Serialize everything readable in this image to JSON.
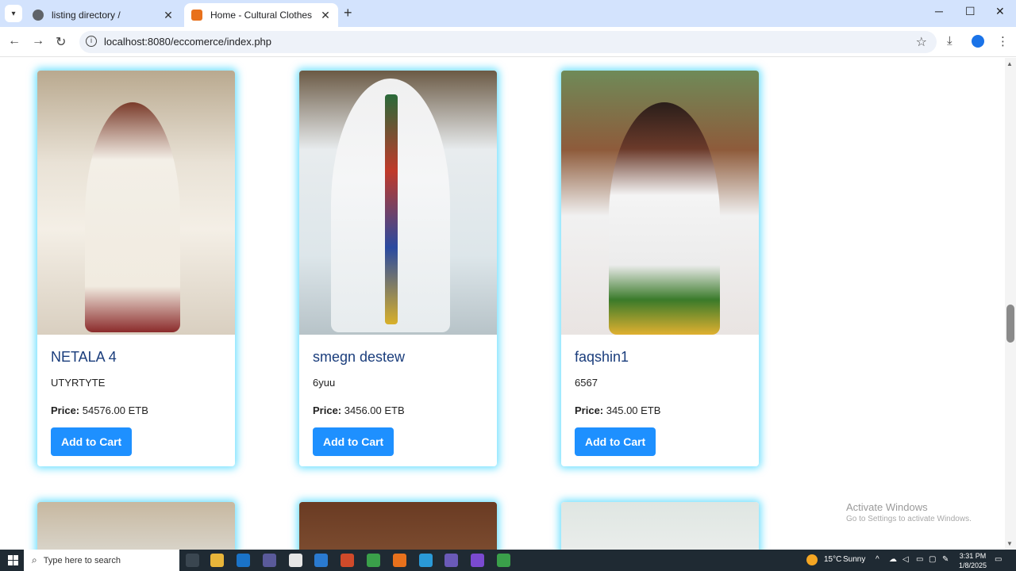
{
  "browser": {
    "tabs": [
      {
        "title": "listing directory /"
      },
      {
        "title": "Home - Cultural Clothes"
      }
    ],
    "url": "localhost:8080/eccomerce/index.php"
  },
  "products": [
    {
      "name": "NETALA 4",
      "description": "UTYRTYTE",
      "price_label": "Price:",
      "price": "54576.00 ETB",
      "button": "Add to Cart"
    },
    {
      "name": "smegn destew",
      "description": "6yuu",
      "price_label": "Price:",
      "price": "3456.00 ETB",
      "button": "Add to Cart"
    },
    {
      "name": "faqshin1",
      "description": "6567",
      "price_label": "Price:",
      "price": "345.00 ETB",
      "button": "Add to Cart"
    }
  ],
  "watermark": {
    "title": "Activate Windows",
    "subtitle": "Go to Settings to activate Windows."
  },
  "taskbar": {
    "search_placeholder": "Type here to search",
    "weather_temp": "15°C",
    "weather_text": "Sunny",
    "time": "3:31 PM",
    "date": "1/8/2025"
  },
  "colors": {
    "accent_button": "#1e90ff",
    "card_glow": "#00c8ff",
    "product_name": "#1a3d7c"
  }
}
